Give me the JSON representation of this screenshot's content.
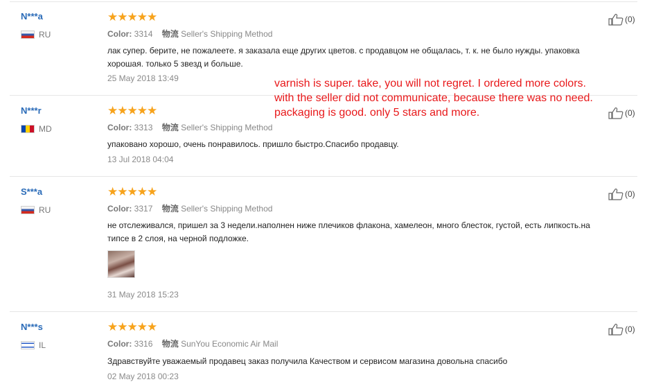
{
  "reviews": [
    {
      "user": "N***a",
      "country": "RU",
      "stars": "★★★★★",
      "color_label": "Color:",
      "color_value": "3314",
      "shipping_label": "物流",
      "shipping_value": "Seller's Shipping Method",
      "text": "лак супер. берите, не пожалеете. я заказала еще других цветов. с продавцом не общалась, т. к. не было нужды. упаковка хорошая. только 5 звезд и больше.",
      "date": "25 May 2018 13:49",
      "helpful": "(0)"
    },
    {
      "user": "N***r",
      "country": "MD",
      "stars": "★★★★★",
      "color_label": "Color:",
      "color_value": "3313",
      "shipping_label": "物流",
      "shipping_value": "Seller's Shipping Method",
      "text": "упаковано хорошо, очень понравилось. пришло быстро.Спасибо продавцу.",
      "date": "13 Jul 2018 04:04",
      "helpful": "(0)"
    },
    {
      "user": "S***a",
      "country": "RU",
      "stars": "★★★★★",
      "color_label": "Color:",
      "color_value": "3317",
      "shipping_label": "物流",
      "shipping_value": "Seller's Shipping Method",
      "text": "не отслеживался, пришел за 3 недели.наполнен ниже плечиков флакона, хамелеон, много блесток, густой, есть липкость.на типсе в 2 слоя, на черной подложке.",
      "date": "31 May 2018 15:23",
      "helpful": "(0)"
    },
    {
      "user": "N***s",
      "country": "IL",
      "stars": "★★★★★",
      "color_label": "Color:",
      "color_value": "3316",
      "shipping_label": "物流",
      "shipping_value": "SunYou Economic Air Mail",
      "text": "Здравствуйте уважаемый продавец заказ получила Качеством и сервисом магазина довольна спасибо",
      "date": "02 May 2018 00:23",
      "helpful": "(0)"
    }
  ],
  "translation": [
    "varnish is super. take, you will not regret. I ordered more colors.",
    "with the seller did not communicate, because there was no need.",
    "packaging is good. only 5 stars and more."
  ],
  "colors": {
    "stars": "#f7a31c",
    "username": "#2a6bb8",
    "translation": "#e8181a"
  }
}
